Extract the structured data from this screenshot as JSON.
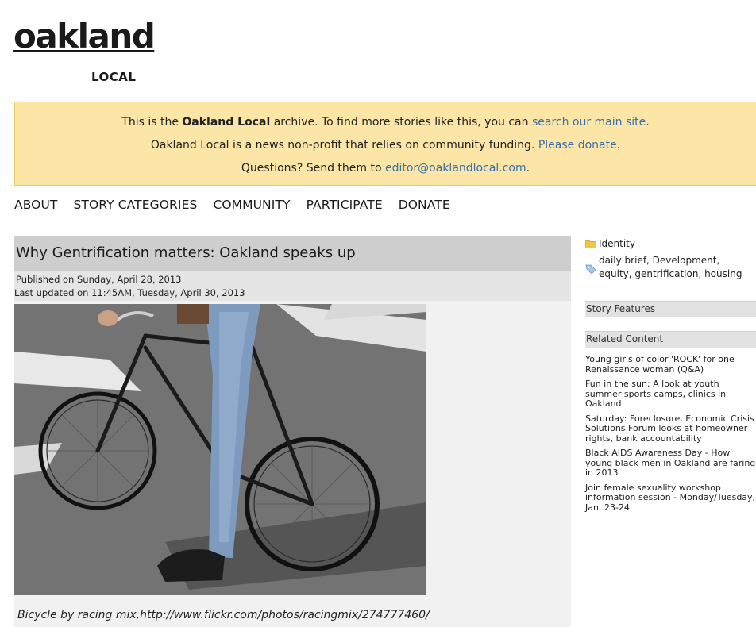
{
  "logo": {
    "word": "oakland",
    "sub": "LOCAL"
  },
  "notice": {
    "line1_pre": "This is the ",
    "line1_bold": "Oakland Local",
    "line1_mid": " archive. To find more stories like this, you can ",
    "line1_link": "search our main site",
    "line1_end": ".",
    "line2_pre": "Oakland Local is a news non-profit that relies on community funding. ",
    "line2_link": "Please donate",
    "line2_end": ".",
    "line3_pre": "Questions? Send them to ",
    "line3_link": "editor@oaklandlocal.com",
    "line3_end": "."
  },
  "nav": [
    "ABOUT",
    "STORY CATEGORIES",
    "COMMUNITY",
    "PARTICIPATE",
    "DONATE"
  ],
  "article": {
    "title": "Why Gentrification matters: Oakland speaks up",
    "published": "Published on Sunday, April 28, 2013",
    "updated": "Last updated on 11:45AM, Tuesday, April 30, 2013",
    "caption": "Bicycle by racing mix,http://www.flickr.com/photos/racingmix/274777460/"
  },
  "sidebar": {
    "category": "Identity",
    "tags_line1": "daily brief, Development,",
    "tags_line2": "equity, gentrification, housing",
    "story_features": "Story Features",
    "related_heading": "Related Content",
    "related": [
      "Young girls of color 'ROCK' for one Renaissance woman (Q&A)",
      "Fun in the sun: A look at youth summer sports camps, clinics in Oakland",
      "Saturday: Foreclosure, Economic Crisis Solutions Forum looks at homeowner rights, bank accountability",
      "Black AIDS Awareness Day - How young black men in Oakland are faring in 2013",
      "Join female sexuality workshop information session - Monday/Tuesday, Jan. 23-24"
    ]
  },
  "icons": {
    "folder": "folder-icon",
    "tag": "tag-icon"
  },
  "colors": {
    "notice_bg": "#fbe5a7",
    "link": "#3a6fa8",
    "title_bar": "#cecece"
  }
}
